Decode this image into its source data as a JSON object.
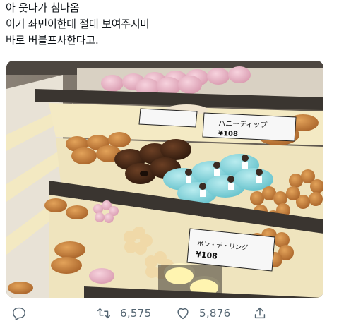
{
  "tweet": {
    "lines": [
      "아 웃다가 침나옴",
      "이거 좌민이한테 절대 보여주지마",
      "바로 버블프사한다고."
    ]
  },
  "photo": {
    "labels": {
      "price_tag_center": "ハニーディップ",
      "price_tag_lower": "ポン・デ・リング",
      "price_value": "¥108"
    }
  },
  "actions": {
    "reply_icon": "reply-icon",
    "retweet_icon": "retweet-icon",
    "retweet_count": "6,575",
    "like_icon": "heart-icon",
    "like_count": "5,876",
    "share_icon": "share-icon"
  }
}
